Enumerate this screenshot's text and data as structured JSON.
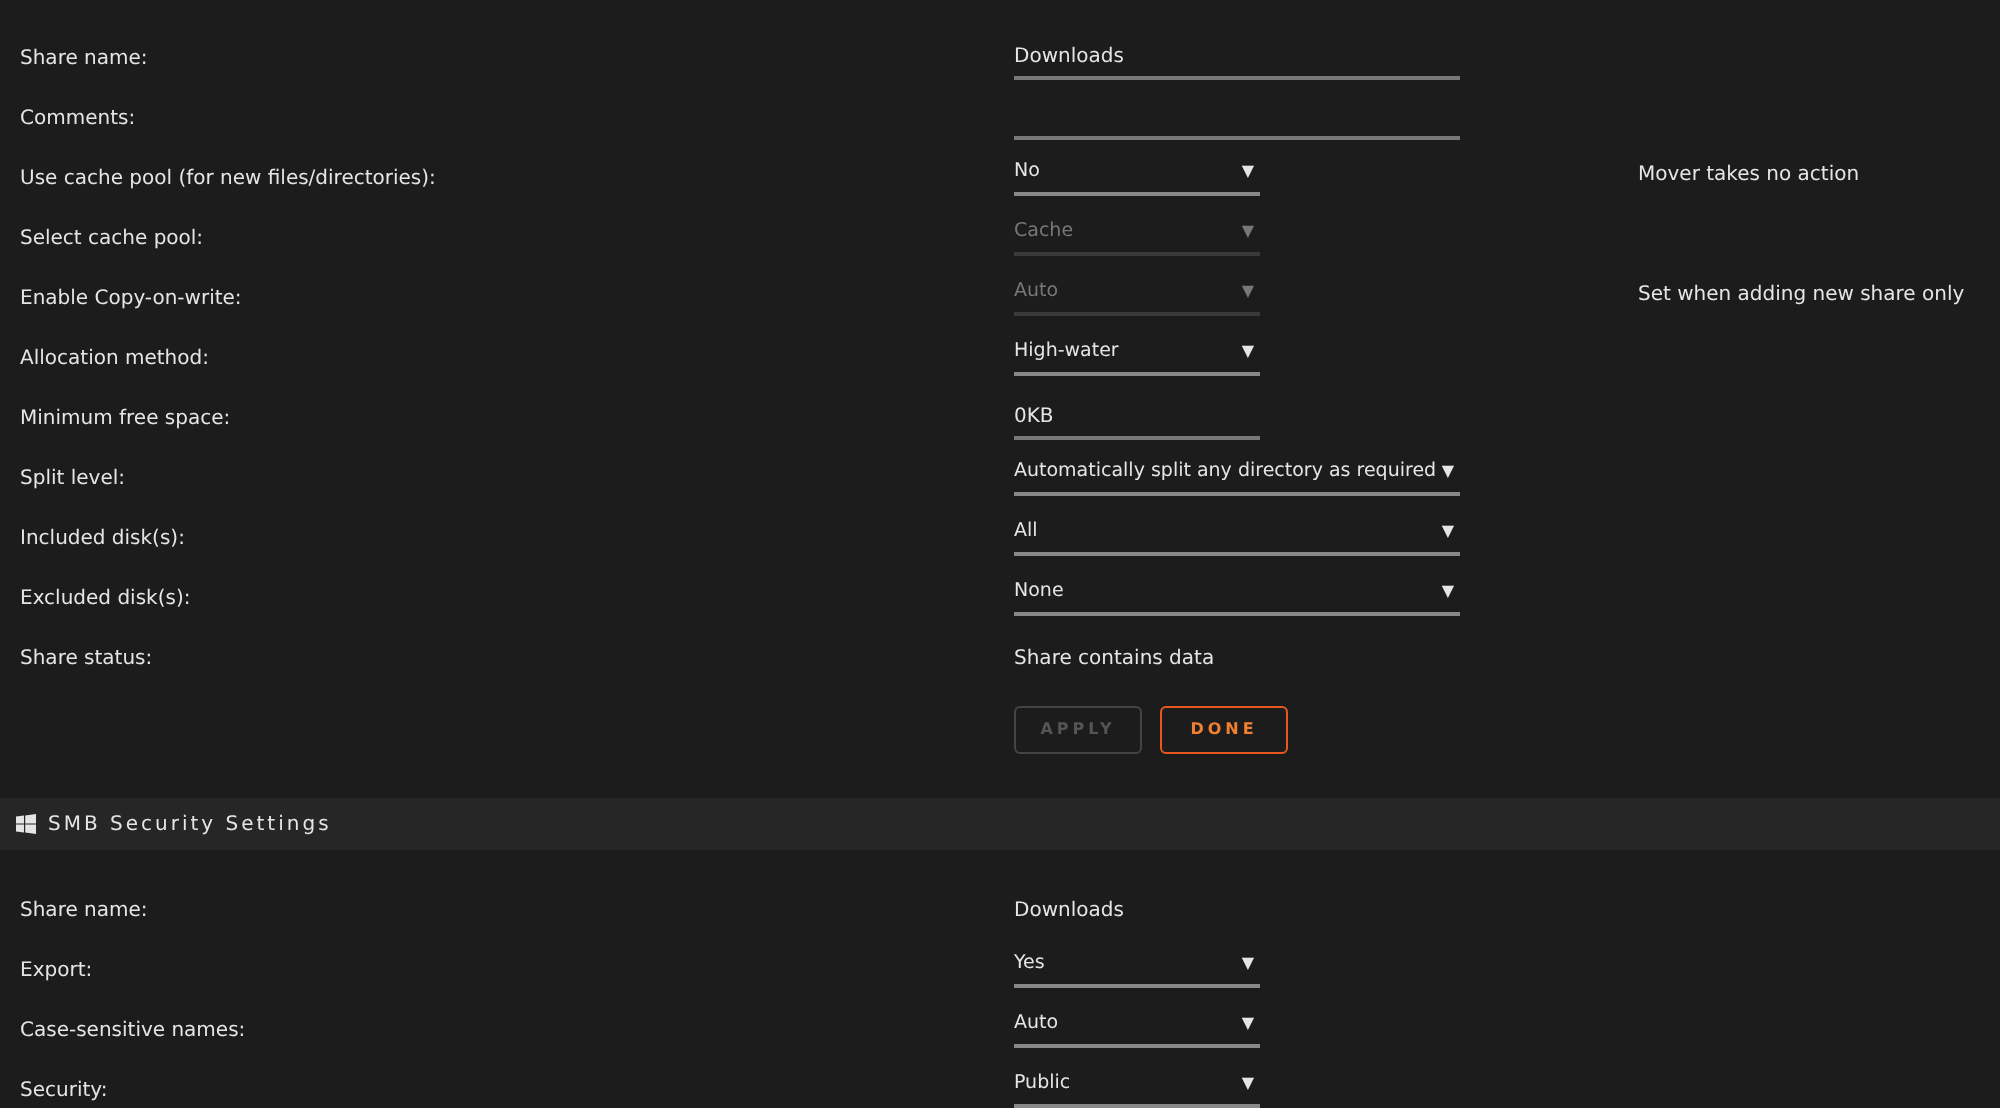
{
  "share_settings": {
    "rows": [
      {
        "label": "Share name:",
        "kind": "input",
        "wide": true,
        "value": "Downloads",
        "disabled": false
      },
      {
        "label": "Comments:",
        "kind": "input",
        "wide": true,
        "disabled": false
      },
      {
        "label": "Use cache pool (for new files/directories):",
        "kind": "select",
        "wide": false,
        "value": "No",
        "arrow": "▼",
        "disabled": false,
        "note": "Mover takes no action"
      },
      {
        "label": "Select cache pool:",
        "kind": "select",
        "wide": false,
        "value": "Cache",
        "arrow": "▼",
        "disabled": true
      },
      {
        "label": "Enable Copy-on-write:",
        "kind": "select",
        "wide": false,
        "value": "Auto",
        "arrow": "▼",
        "disabled": true,
        "note": "Set when adding new share only"
      },
      {
        "label": "Allocation method:",
        "kind": "select",
        "wide": false,
        "value": "High-water",
        "arrow": "▼",
        "disabled": false
      },
      {
        "label": "Minimum free space:",
        "kind": "input",
        "wide": false,
        "value": "0KB",
        "disabled": false
      },
      {
        "label": "Split level:",
        "kind": "select",
        "wide": true,
        "value": "Automatically split any directory as required",
        "arrow": "▼",
        "disabled": false
      },
      {
        "label": "Included disk(s):",
        "kind": "select",
        "wide": true,
        "value": "All",
        "arrow": "▼",
        "disabled": false
      },
      {
        "label": "Excluded disk(s):",
        "kind": "select",
        "wide": true,
        "value": "None",
        "arrow": "▼",
        "disabled": false
      },
      {
        "label": "Share status:",
        "kind": "text",
        "value": "Share contains data"
      }
    ],
    "buttons": [
      {
        "label": "APPLY",
        "disabled": true
      },
      {
        "label": "DONE",
        "disabled": false
      }
    ]
  },
  "smb_section": {
    "title": "SMB Security Settings",
    "rows": [
      {
        "label": "Share name:",
        "kind": "text",
        "value": "Downloads"
      },
      {
        "label": "Export:",
        "kind": "select",
        "wide": false,
        "value": "Yes",
        "arrow": "▼",
        "disabled": false
      },
      {
        "label": "Case-sensitive names:",
        "kind": "select",
        "wide": false,
        "value": "Auto",
        "arrow": "▼",
        "disabled": false
      },
      {
        "label": "Security:",
        "kind": "select",
        "wide": false,
        "value": "Public",
        "arrow": "▼",
        "disabled": false
      }
    ]
  }
}
